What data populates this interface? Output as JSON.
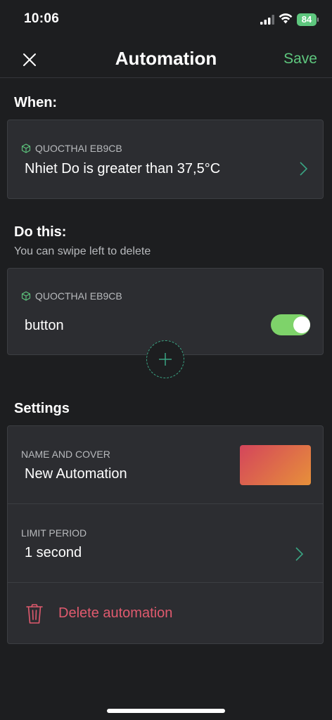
{
  "status": {
    "time": "10:06",
    "battery": "84"
  },
  "header": {
    "title": "Automation",
    "save_label": "Save"
  },
  "when": {
    "heading": "When:",
    "device": "QUOCTHAI EB9CB",
    "condition": "Nhiet Do is greater than 37,5°C"
  },
  "do_this": {
    "heading": "Do this:",
    "hint": "You can swipe left to delete",
    "device": "QUOCTHAI EB9CB",
    "action": "button",
    "toggle_on": true
  },
  "settings": {
    "heading": "Settings",
    "name_label": "NAME AND COVER",
    "name_value": "New Automation",
    "limit_label": "LIMIT PERIOD",
    "limit_value": "1 second",
    "delete_label": "Delete automation"
  },
  "colors": {
    "accent": "#5ec77e",
    "toggle": "#7ed36a",
    "danger": "#e05a6e"
  }
}
